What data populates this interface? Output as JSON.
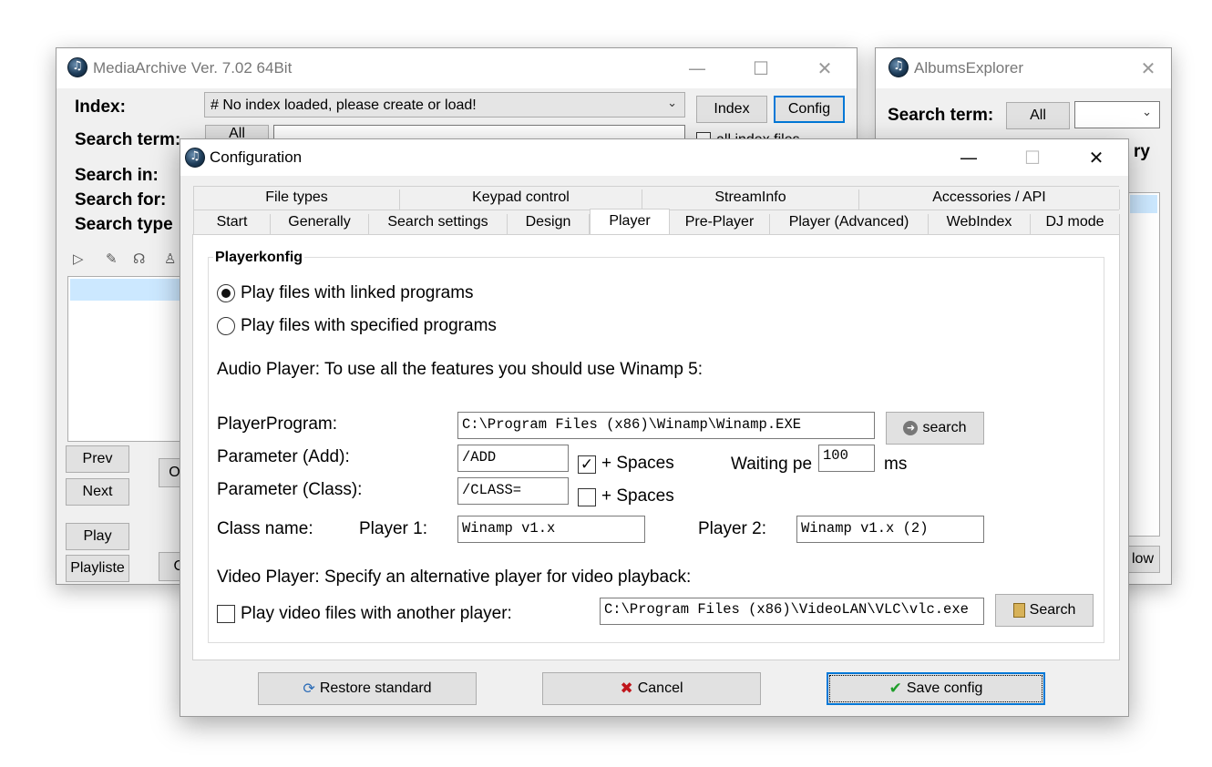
{
  "media_archive": {
    "title": "MediaArchive Ver. 7.02 64Bit",
    "index_label": "Index:",
    "index_combo": "# No index loaded, please create or load!",
    "index_button": "Index",
    "config_button": "Config",
    "search_term_label": "Search term:",
    "all_button": "All",
    "all_index_files": "all index files",
    "search_in_label": "Search in:",
    "search_for_label": "Search for:",
    "search_type_label": "Search type",
    "prev_button": "Prev",
    "next_button": "Next",
    "play_button": "Play",
    "playlist_button": "Playliste",
    "or_button_1": "Or",
    "or_button_2": "O"
  },
  "albums_explorer": {
    "title": "AlbumsExplorer",
    "search_term_label": "Search term:",
    "all_button": "All",
    "side_label": "ry",
    "bottom_button": "low"
  },
  "config": {
    "title": "Configuration",
    "tabs_row1": [
      "File types",
      "Keypad control",
      "StreamInfo",
      "Accessories / API"
    ],
    "tabs_row2": [
      "Start",
      "Generally",
      "Search settings",
      "Design",
      "Player",
      "Pre-Player",
      "Player (Advanced)",
      "WebIndex",
      "DJ mode"
    ],
    "group_title": "Playerkonfig",
    "radio_linked": "Play files with linked programs",
    "radio_specified": "Play files with specified programs",
    "audio_note": "Audio Player: To use all the features you should use Winamp 5:",
    "player_program_label": "PlayerProgram:",
    "player_program_value": "C:\\Program Files (x86)\\Winamp\\Winamp.EXE",
    "search_button": "search",
    "param_add_label": "Parameter (Add):",
    "param_add_value": "/ADD",
    "spaces_label": "+ Spaces",
    "spaces_add_checked": true,
    "waiting_label": "Waiting pe",
    "waiting_value": "100",
    "ms_label": "ms",
    "param_class_label": "Parameter (Class):",
    "param_class_value": "/CLASS=",
    "spaces_class_checked": false,
    "class_name_label": "Class name:",
    "player1_label": "Player 1:",
    "player1_value": "Winamp v1.x",
    "player2_label": "Player 2:",
    "player2_value": "Winamp v1.x (2)",
    "video_note": "Video Player: Specify an alternative player for video playback:",
    "video_check_label": "Play video files with another player:",
    "video_checked": false,
    "video_path_value": "C:\\Program Files (x86)\\VideoLAN\\VLC\\vlc.exe",
    "video_search_button": "Search",
    "restore_button": "Restore standard",
    "cancel_button": "Cancel",
    "save_button": "Save config",
    "colors": {
      "cancel_icon": "#c0161c",
      "save_icon": "#1f9e2a",
      "focus": "#0078d7"
    }
  }
}
